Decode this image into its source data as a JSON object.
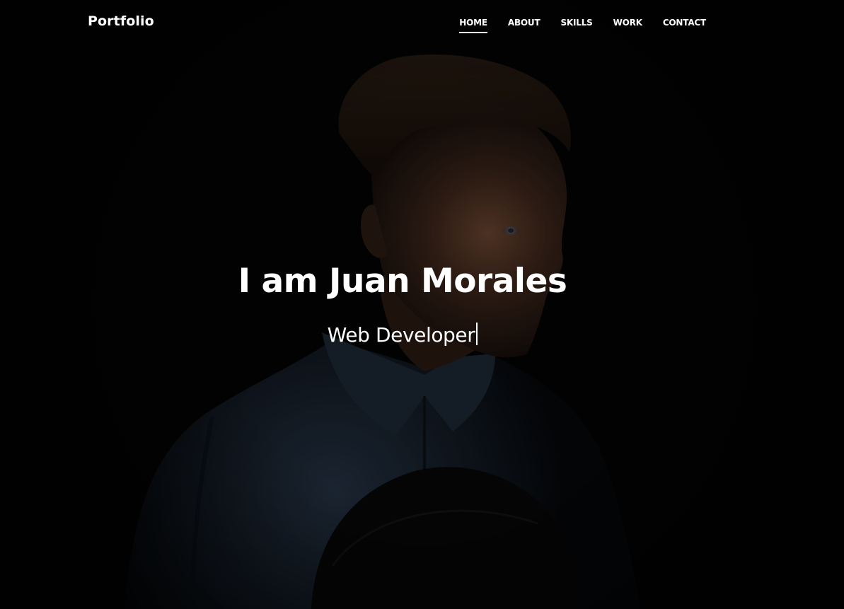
{
  "nav": {
    "brand": "Portfolio",
    "links": [
      {
        "label": "HOME",
        "active": true
      },
      {
        "label": "ABOUT",
        "active": false
      },
      {
        "label": "SKILLS",
        "active": false
      },
      {
        "label": "WORK",
        "active": false
      },
      {
        "label": "CONTACT",
        "active": false
      }
    ]
  },
  "hero": {
    "headline": "I am Juan Morales",
    "role": "Web Developer",
    "background_image": "dark-portrait-photo",
    "overlay_color": "#000000"
  },
  "colors": {
    "text": "#ffffff",
    "background": "#020202"
  }
}
